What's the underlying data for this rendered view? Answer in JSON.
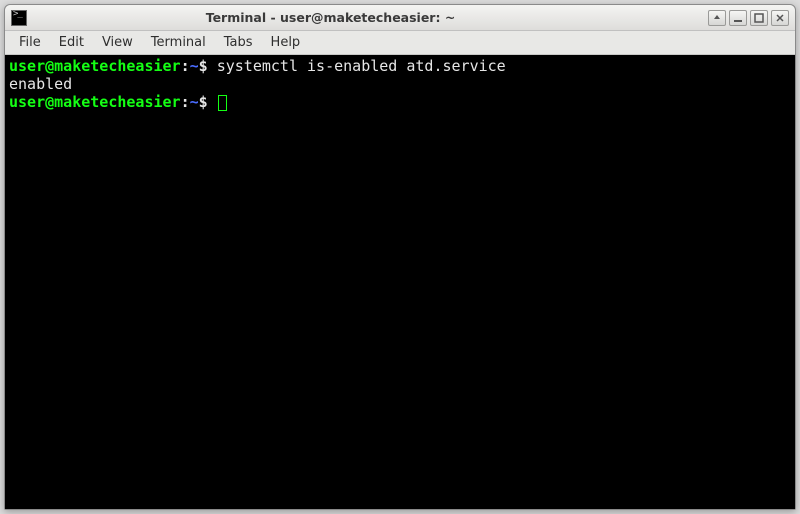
{
  "window": {
    "title": "Terminal - user@maketecheasier: ~"
  },
  "menubar": {
    "items": [
      "File",
      "Edit",
      "View",
      "Terminal",
      "Tabs",
      "Help"
    ]
  },
  "terminal": {
    "lines": [
      {
        "prompt_user": "user@maketecheasier",
        "prompt_sep1": ":",
        "prompt_path": "~",
        "prompt_sep2": "$ ",
        "command": "systemctl is-enabled atd.service"
      },
      {
        "output": "enabled"
      },
      {
        "prompt_user": "user@maketecheasier",
        "prompt_sep1": ":",
        "prompt_path": "~",
        "prompt_sep2": "$ ",
        "command": "",
        "cursor": true
      }
    ]
  }
}
